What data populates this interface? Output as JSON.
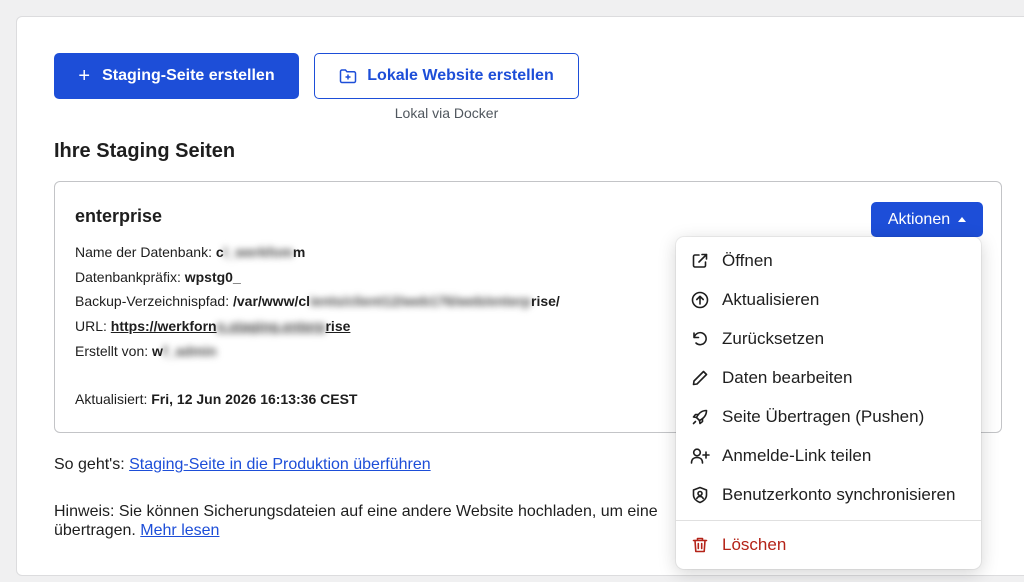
{
  "buttons": {
    "create_staging": "Staging-Seite erstellen",
    "create_staging_icon": "plus-icon",
    "create_local": "Lokale Website erstellen",
    "create_local_icon": "folder-plus-icon",
    "create_local_sub": "Lokal via Docker"
  },
  "section_title": "Ihre Staging Seiten",
  "site": {
    "name": "enterprise",
    "db_name_label": "Name der Datenbank:",
    "db_name_visible_start": "c",
    "db_name_blurred": "l_werkfom",
    "db_name_visible_end": "m",
    "db_prefix_label": "Datenbankpräfix:",
    "db_prefix": "wpstg0_",
    "backup_label": "Backup-Verzeichnispfad:",
    "backup_start": "/var/www/cl",
    "backup_blurred": "ients/client12/web176/web/enterp",
    "backup_end": "rise/",
    "url_label": "URL:",
    "url_start": "https://werkforn",
    "url_blurred": "n.staging.enterp",
    "url_end": "rise",
    "created_by_label": "Erstellt von:",
    "created_by_start": "w",
    "created_by_blurred": "f_admin",
    "updated_label": "Aktualisiert:",
    "updated_value": "Fri, 12 Jun 2026 16:13:36 CEST"
  },
  "actions_button": "Aktionen",
  "menu": [
    {
      "label": "Öffnen",
      "icon": "external-link-icon"
    },
    {
      "label": "Aktualisieren",
      "icon": "arrow-up-circle-icon"
    },
    {
      "label": "Zurücksetzen",
      "icon": "undo-icon"
    },
    {
      "label": "Daten bearbeiten",
      "icon": "pencil-icon"
    },
    {
      "label": "Seite Übertragen (Pushen)",
      "icon": "rocket-icon"
    },
    {
      "label": "Anmelde-Link teilen",
      "icon": "user-plus-icon"
    },
    {
      "label": "Benutzerkonto synchronisieren",
      "icon": "shield-user-icon"
    },
    {
      "label": "Löschen",
      "icon": "trash-icon"
    }
  ],
  "howto": {
    "prefix": "So geht's:",
    "link": "Staging-Seite in die Produktion überführen"
  },
  "note": {
    "text_line1": "Hinweis: Sie können Sicherungsdateien auf eine andere Website hochladen, um eine",
    "text_line2": "übertragen.",
    "link": "Mehr lesen"
  },
  "colors": {
    "primary": "#1d4ed8",
    "danger": "#b42318"
  }
}
